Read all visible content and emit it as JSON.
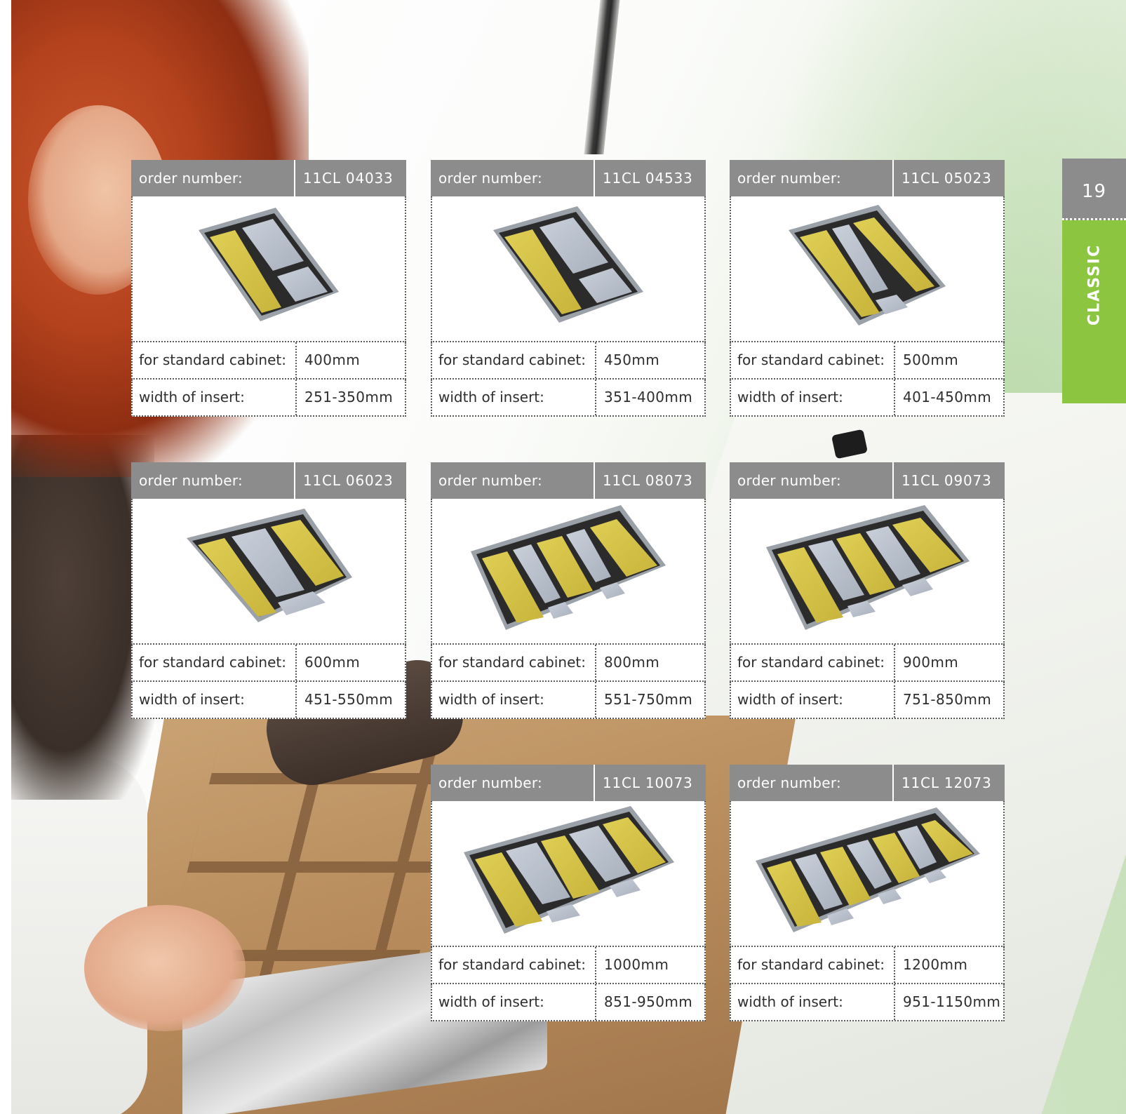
{
  "page": {
    "number": "19",
    "section": "CLASSIC",
    "colors": {
      "header_grey": "#8d8c8c",
      "tab_green": "#8cc53f",
      "tray_gold": "#d8c64a",
      "tray_silver": "#b9c2cf"
    }
  },
  "labels": {
    "order_number": "order number:",
    "standard_cabinet": "for standard cabinet:",
    "insert_width": "width of insert:"
  },
  "products": [
    {
      "order_number": "11CL 04033",
      "cabinet": "400mm",
      "insert_width": "251-350mm",
      "tray_icon": "cutlery-tray-2-compartment"
    },
    {
      "order_number": "11CL 04533",
      "cabinet": "450mm",
      "insert_width": "351-400mm",
      "tray_icon": "cutlery-tray-2-compartment"
    },
    {
      "order_number": "11CL 05023",
      "cabinet": "500mm",
      "insert_width": "401-450mm",
      "tray_icon": "cutlery-tray-3-compartment"
    },
    {
      "order_number": "11CL 06023",
      "cabinet": "600mm",
      "insert_width": "451-550mm",
      "tray_icon": "cutlery-tray-3-compartment"
    },
    {
      "order_number": "11CL 08073",
      "cabinet": "800mm",
      "insert_width": "551-750mm",
      "tray_icon": "cutlery-tray-5-compartment"
    },
    {
      "order_number": "11CL 09073",
      "cabinet": "900mm",
      "insert_width": "751-850mm",
      "tray_icon": "cutlery-tray-5-compartment"
    },
    {
      "order_number": "11CL 10073",
      "cabinet": "1000mm",
      "insert_width": "851-950mm",
      "tray_icon": "cutlery-tray-5-compartment"
    },
    {
      "order_number": "11CL 12073",
      "cabinet": "1200mm",
      "insert_width": "951-1150mm",
      "tray_icon": "cutlery-tray-7-compartment"
    }
  ]
}
